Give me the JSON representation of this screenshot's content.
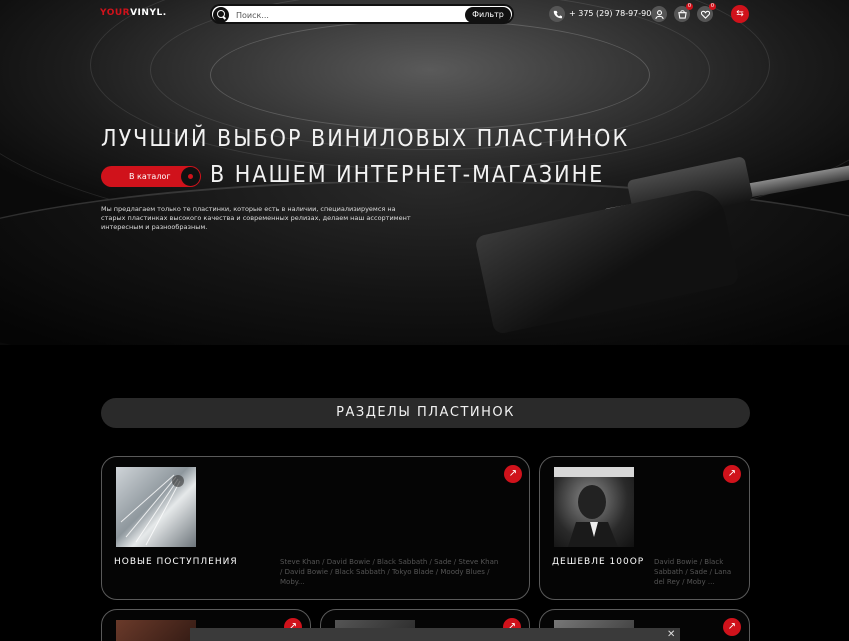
{
  "header": {
    "logo_left": "YOUR",
    "logo_right": "VINYL.",
    "search_placeholder": "Поиск...",
    "filter_label": "Фильтр",
    "phone": "+ 375 (29) 78-97-90",
    "cart_count": "0",
    "fav_count": "0",
    "menu_icon": "⇆"
  },
  "hero": {
    "line1": "ЛУЧШИЙ ВЫБОР ВИНИЛОВЫХ ПЛАСТИНОК",
    "line2": "В НАШЕМ ИНТЕРНЕТ-МАГАЗИНЕ",
    "catalog_label": "В каталог",
    "description": "Мы предлагаем только те пластинки, которые есть в наличии, специализируемся на старых пластинках высокого качества и современных релизах, делаем наш ассортимент интересным и разнообразным."
  },
  "sections": {
    "title": "РАЗДЕЛЫ ПЛАСТИНОК",
    "cards": [
      {
        "title": "НОВЫЕ ПОСТУПЛЕНИЯ",
        "desc": "Steve Khan / David Bowie / Black Sabbath / Sade / Steve Khan / David Bowie / Black Sabbath / Tokyo Blade / Moody Blues / Moby..."
      },
      {
        "title": "ДЕШЕВЛЕ 100ОР",
        "desc": "David Bowie / Black Sabbath / Sade / Lana del Rey / Moby ..."
      }
    ],
    "arrow_icon": "↗"
  },
  "popup_close": "✕"
}
